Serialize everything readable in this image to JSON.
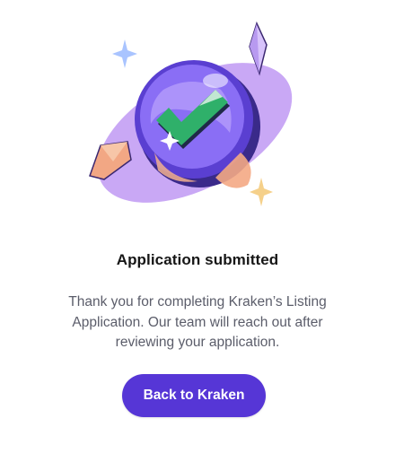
{
  "illustration": {
    "description_icon": "checkmark-coin-icon",
    "colors": {
      "ellipse": "#c9a8f5",
      "coin_rim": "#5a3fd1",
      "coin_face": "#8a6ef5",
      "check": "#2fb06a",
      "sparkle_blue": "#a9c4ff",
      "sparkle_gold": "#f5d08a",
      "crystal_orange": "#f2a784",
      "crystal_purple": "#d7c3fb"
    }
  },
  "dialog": {
    "title": "Application submitted",
    "message": "Thank you for completing Kraken’s Listing Application. Our team will reach out after reviewing your application.",
    "button_label": "Back to Kraken"
  },
  "colors": {
    "accent": "#5636d6",
    "title_text": "#161616",
    "body_text": "#5b5d6a"
  }
}
